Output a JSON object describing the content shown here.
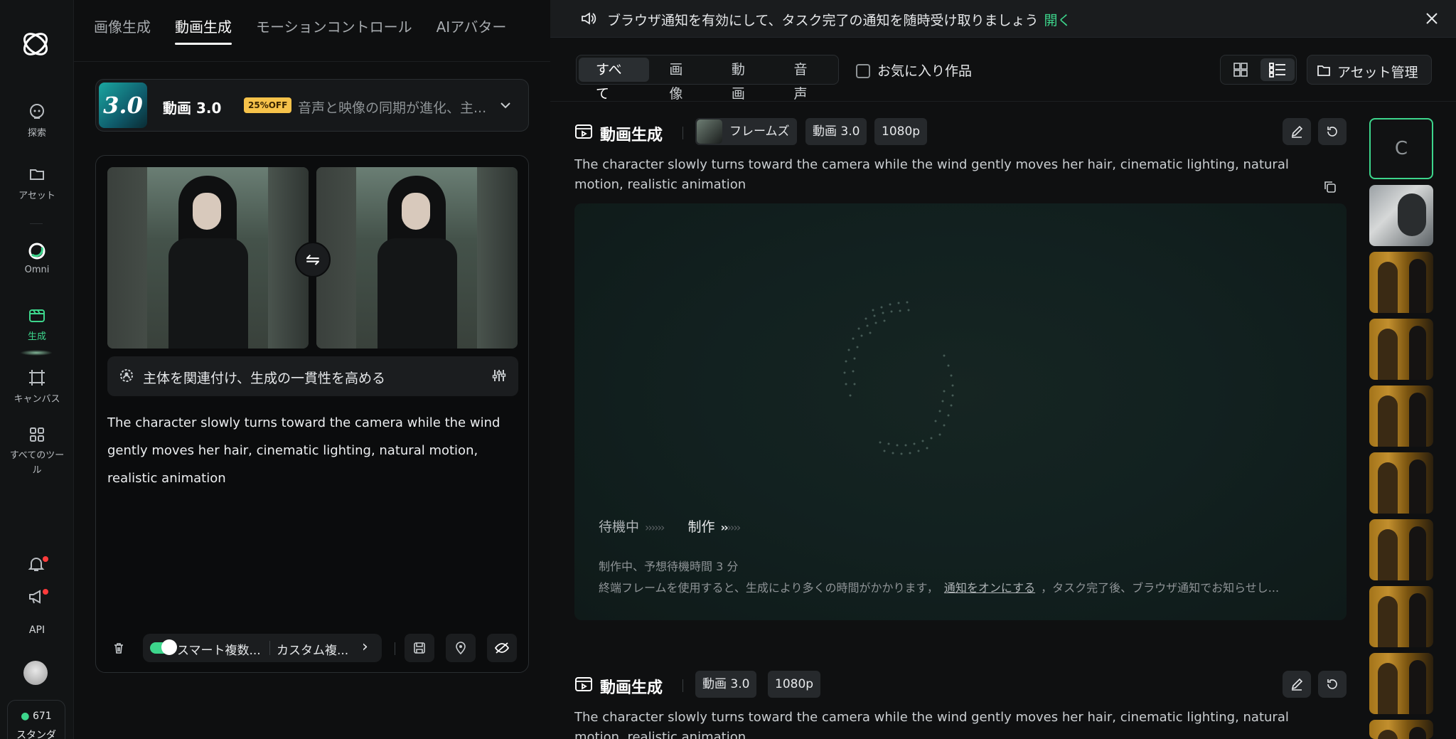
{
  "nav": {
    "items": [
      {
        "label": "探索"
      },
      {
        "label": "アセット"
      },
      {
        "label": "Omni"
      },
      {
        "label": "生成"
      },
      {
        "label": "キャンバス"
      },
      {
        "label": "すべてのツール"
      }
    ],
    "api_label": "API",
    "credits": "671",
    "credits_label": "スタンダ"
  },
  "left": {
    "tabs": [
      {
        "label": "画像生成"
      },
      {
        "label": "動画生成"
      },
      {
        "label": "モーションコントロール"
      },
      {
        "label": "AIアバター"
      }
    ],
    "active_tab": "動画生成",
    "model": {
      "badge_text": "3.0",
      "name": "動画 3.0",
      "discount": "25%OFF",
      "description": "音声と映像の同期が進化、主..."
    },
    "subject_bar": "主体を関連付け、生成の一貫性を高める",
    "prompt": "The character slowly turns toward the camera while the wind gently moves her hair, cinematic lighting, natural motion, realistic animation",
    "toolbar": {
      "smart_label": "スマート複数...",
      "custom_label": "カスタム複...",
      "smart_enabled": true
    }
  },
  "right": {
    "notice": {
      "text": "ブラウザ通知を有効にして、タスク完了の通知を随時受け取りましょう",
      "link": "開く"
    },
    "filters": [
      {
        "label": "すべて"
      },
      {
        "label": "画像"
      },
      {
        "label": "動画"
      },
      {
        "label": "音声"
      }
    ],
    "active_filter": "すべて",
    "favorites_label": "お気に入り作品",
    "asset_button": "アセット管理",
    "tasks": [
      {
        "title": "動画生成",
        "chips": [
          "フレームズ",
          "動画 3.0",
          "1080p"
        ],
        "prompt": "The character slowly turns toward the camera while the wind gently moves her hair, cinematic lighting, natural motion, realistic animation",
        "status_waiting": "待機中",
        "status_making": "制作",
        "note1": "制作中、予想待機時間 3 分",
        "note2_a": "終端フレームを使用すると、生成により多くの時間がかかります，",
        "note2_link": "通知をオンにする",
        "note2_b": "，タスク完了後、ブラウザ通知でお知らせし..."
      },
      {
        "title": "動画生成",
        "chips": [
          "動画 3.0",
          "1080p"
        ],
        "prompt": "The character slowly turns toward the camera while the wind gently moves her hair, cinematic lighting, natural motion, realistic animation"
      }
    ],
    "first_thumb_letter": "C"
  },
  "colors": {
    "accent": "#3dd68c",
    "discount_badge": "#f6c24a",
    "alert_dot": "#ff3b3b"
  },
  "icons": [
    "logo-icon",
    "explore-icon",
    "folder-icon",
    "omni-icon",
    "generate-icon",
    "canvas-icon",
    "grid-icon",
    "bell-icon",
    "megaphone-icon",
    "chevron-down-icon",
    "swap-icon",
    "subject-link-icon",
    "sliders-icon",
    "trash-icon",
    "save-icon",
    "pin-icon",
    "eye-off-icon",
    "speaker-icon",
    "close-icon",
    "grid-view-icon",
    "list-view-icon",
    "video-icon",
    "edit-icon",
    "retry-icon",
    "copy-icon"
  ]
}
